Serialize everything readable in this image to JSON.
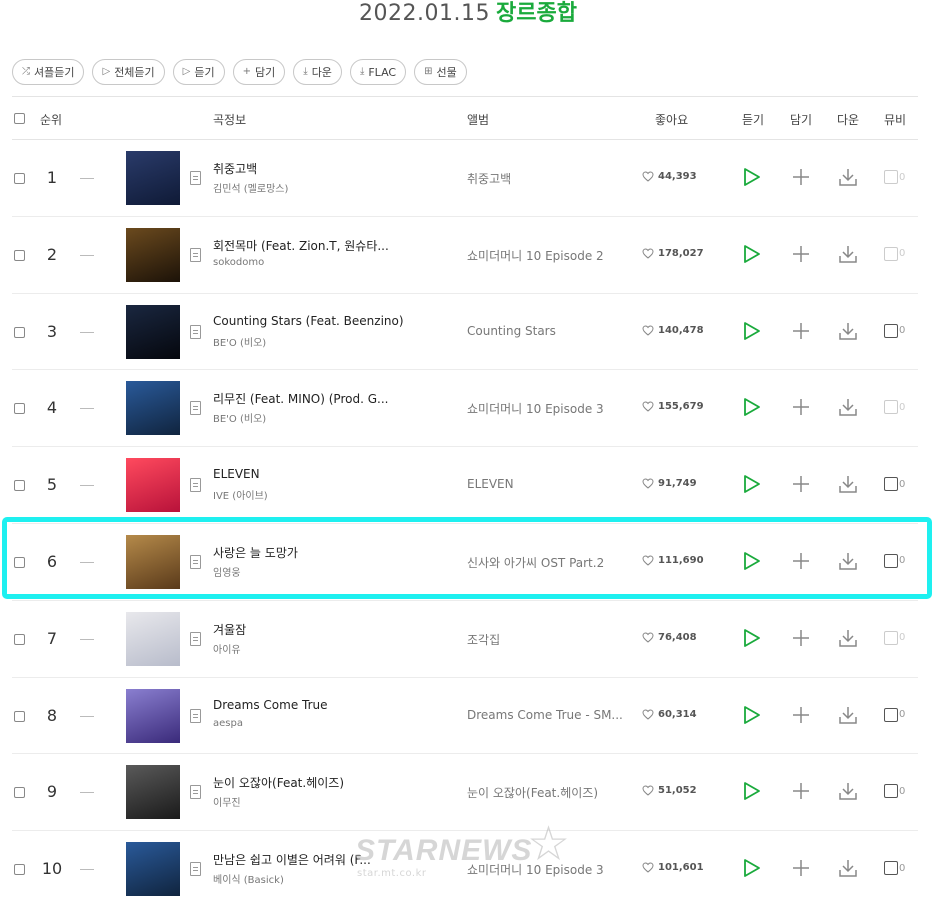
{
  "header": {
    "date": "2022.01.15",
    "genre": "장르종합"
  },
  "toolbar": {
    "buttons": [
      {
        "icon": "shuffle-icon",
        "glyph": "⤮",
        "label": "셔플듣기"
      },
      {
        "icon": "play-icon",
        "glyph": "▷",
        "label": "전체듣기"
      },
      {
        "icon": "play-icon",
        "glyph": "▷",
        "label": "듣기"
      },
      {
        "icon": "plus-icon",
        "glyph": "+",
        "label": "담기"
      },
      {
        "icon": "download-icon",
        "glyph": "⤓",
        "label": "다운"
      },
      {
        "icon": "download-icon",
        "glyph": "⤓",
        "label": "FLAC"
      },
      {
        "icon": "gift-icon",
        "glyph": "⊞",
        "label": "선물"
      }
    ]
  },
  "columns": {
    "rank": "순위",
    "song": "곡정보",
    "album": "앨범",
    "likes": "좋아요",
    "listen": "듣기",
    "add": "담기",
    "download": "다운",
    "mv": "뮤비"
  },
  "accent_color": "#1aaa3c",
  "highlight_color": "#1ef0f0",
  "rows": [
    {
      "rank": "1",
      "title": "취중고백",
      "artist": "김민석 (멜로망스)",
      "album": "취중고백",
      "likes": "44,393",
      "mv": "0",
      "mv_enabled": false,
      "art": [
        "#2a3b6a",
        "#0f1a36"
      ]
    },
    {
      "rank": "2",
      "title": "회전목마 (Feat. Zion.T, 원슈타...",
      "artist": "sokodomo",
      "album": "쇼미더머니 10 Episode 2",
      "likes": "178,027",
      "mv": "0",
      "mv_enabled": false,
      "art": [
        "#6b4a1e",
        "#1c1208"
      ]
    },
    {
      "rank": "3",
      "title": "Counting Stars (Feat. Beenzino)",
      "artist": "BE'O (비오)",
      "album": "Counting Stars",
      "likes": "140,478",
      "mv": "0",
      "mv_enabled": true,
      "art": [
        "#1a2740",
        "#05070d"
      ]
    },
    {
      "rank": "4",
      "title": "리무진 (Feat. MINO) (Prod. G...",
      "artist": "BE'O (비오)",
      "album": "쇼미더머니 10 Episode 3",
      "likes": "155,679",
      "mv": "0",
      "mv_enabled": false,
      "art": [
        "#2a5a9a",
        "#10243e"
      ]
    },
    {
      "rank": "5",
      "title": "ELEVEN",
      "artist": "IVE (아이브)",
      "album": "ELEVEN",
      "likes": "91,749",
      "mv": "0",
      "mv_enabled": true,
      "art": [
        "#ff4a5e",
        "#b8123a"
      ]
    },
    {
      "rank": "6",
      "title": "사랑은 늘 도망가",
      "artist": "임영웅",
      "album": "신사와 아가씨 OST Part.2",
      "likes": "111,690",
      "mv": "0",
      "mv_enabled": true,
      "art": [
        "#b58a4a",
        "#5a3a1a"
      ]
    },
    {
      "rank": "7",
      "title": "겨울잠",
      "artist": "아이유",
      "album": "조각집",
      "likes": "76,408",
      "mv": "0",
      "mv_enabled": false,
      "art": [
        "#e8e8ec",
        "#b8bccb"
      ]
    },
    {
      "rank": "8",
      "title": "Dreams Come True",
      "artist": "aespa",
      "album": "Dreams Come True - SM...",
      "likes": "60,314",
      "mv": "0",
      "mv_enabled": true,
      "art": [
        "#8a7fd0",
        "#3a2a7a"
      ]
    },
    {
      "rank": "9",
      "title": "눈이 오잖아(Feat.헤이즈)",
      "artist": "이무진",
      "album": "눈이 오잖아(Feat.헤이즈)",
      "likes": "51,052",
      "mv": "0",
      "mv_enabled": true,
      "art": [
        "#5a5a5a",
        "#1a1a1a"
      ]
    },
    {
      "rank": "10",
      "title": "만남은 쉽고 이별은 어려워 (F...",
      "artist": "베이식 (Basick)",
      "album": "쇼미더머니 10 Episode 3",
      "likes": "101,601",
      "mv": "0",
      "mv_enabled": true,
      "art": [
        "#2a5a9a",
        "#10243e"
      ]
    }
  ],
  "watermark": {
    "main": "STARNEWS",
    "sub": "star.mt.co.kr",
    "star": "☆"
  }
}
